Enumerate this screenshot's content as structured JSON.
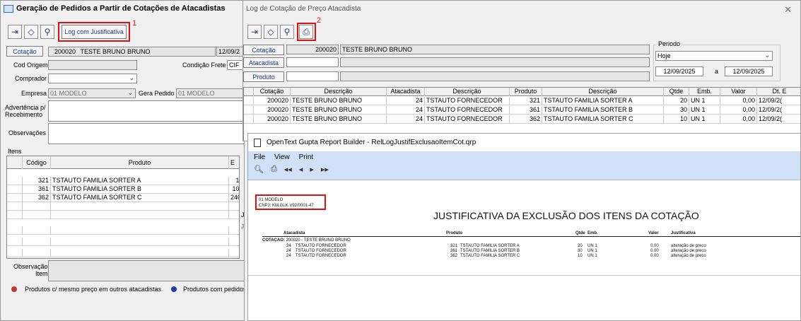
{
  "win1": {
    "title": "Geração de Pedidos a Partir de Cotações de Atacadistas",
    "log_button": "Log com Justificativa",
    "callout": "1",
    "cotacao_button": "Cotação",
    "cotacao_code": "200020",
    "cotacao_name": "TESTE BRUNO BRUNO",
    "cotacao_date": "12/09/2",
    "cod_origem_label": "Cod Origem",
    "condicao_frete_label": "Condição Frete",
    "condicao_frete_value": "CIF",
    "comprador_label": "Comprador",
    "empresa_label": "Empresa",
    "empresa_value": "01 MODELO",
    "gera_pedido_label": "Gera Pedido",
    "gera_pedido_value": "01 MODELO",
    "advertencia_label_1": "Advertência p/",
    "advertencia_label_2": "Recebimento",
    "observacoes_label": "Observações",
    "itens_label": "Itens",
    "items_headers": [
      "Código",
      "Produto",
      "E"
    ],
    "items": [
      {
        "codigo": "321",
        "produto": "TSTAUTO FAMILIA SORTER A",
        "e": "1,"
      },
      {
        "codigo": "361",
        "produto": "TSTAUTO FAMILIA SORTER B",
        "e": "10,"
      },
      {
        "codigo": "362",
        "produto": "TSTAUTO FAMILIA SORTER C",
        "e": "240,"
      }
    ],
    "side_label_j": "J",
    "side_label_ja": "Ja",
    "obs_item_label_1": "Observação",
    "obs_item_label_2": "Item",
    "legend_1": "Produtos c/ mesmo preço em outros atacadistas",
    "legend_2": "Produtos com pedidos e",
    "legend_1_color": "#c0392b",
    "legend_2_color": "#1f3fa6"
  },
  "win2": {
    "title": "Log de Cotação de Preço Atacadista",
    "callout": "2",
    "cotacao_button": "Cotação",
    "cotacao_code": "200020",
    "cotacao_name": "TESTE BRUNO BRUNO",
    "atacadista_button": "Atacadista",
    "produto_button": "Produto",
    "periodo_label": "Periodo",
    "periodo_value": "Hoje",
    "date_from": "12/09/2025",
    "date_sep": "a",
    "date_to": "12/09/2025",
    "headers": [
      "Cotação",
      "Descrição",
      "Atacadista",
      "Descrição",
      "Produto",
      "Descrição",
      "Qtde",
      "Emb.",
      "Valor",
      "Dt. E"
    ],
    "rows": [
      {
        "cot": "200020",
        "desc": "TESTE BRUNO BRUNO",
        "atac": "24",
        "desc2": "TSTAUTO FORNECEDOR",
        "prod": "321",
        "desc3": "TSTAUTO FAMILIA SORTER A",
        "qtde": "20",
        "emb": "UN 1",
        "valor": "0,00",
        "dt": "12/09/2("
      },
      {
        "cot": "200020",
        "desc": "TESTE BRUNO BRUNO",
        "atac": "24",
        "desc2": "TSTAUTO FORNECEDOR",
        "prod": "361",
        "desc3": "TSTAUTO FAMILIA SORTER B",
        "qtde": "30",
        "emb": "UN 1",
        "valor": "0,00",
        "dt": "12/09/2("
      },
      {
        "cot": "200020",
        "desc": "TESTE BRUNO BRUNO",
        "atac": "24",
        "desc2": "TSTAUTO FORNECEDOR",
        "prod": "362",
        "desc3": "TSTAUTO FAMILIA SORTER C",
        "qtde": "10",
        "emb": "UN 1",
        "valor": "0,00",
        "dt": "12/09/2("
      }
    ]
  },
  "win3": {
    "title": "OpenText Gupta Report Builder - RelLogJustifExclusaoItemCot.qrp",
    "menu": [
      "File",
      "View",
      "Print"
    ],
    "report": {
      "company": "01 MODELO",
      "cnpj": "CNPJ: KM.GLK.V92/0001-47",
      "heading": "JUSTIFICATIVA DA EXCLUSÃO DOS ITENS DA COTAÇÃO",
      "col_atacadista": "Atacadista",
      "col_produto": "Produto",
      "col_qtde": "Qtde",
      "col_emb": "Emb.",
      "col_valor": "Valor",
      "col_justificativa": "Justificativa",
      "cotacao_label": "COTAÇAO:",
      "cotacao_value": "200020 - TESTE BRUNO BRUNO",
      "lines": [
        {
          "atac": "24",
          "atac_name": "TSTAUTO FORNECEDOR",
          "prod": "321",
          "prod_name": "TSTAUTO FAMILIA SORTER A",
          "qtde": "20",
          "emb": "UN 1",
          "valor": "0.00",
          "just": "alteração de preco"
        },
        {
          "atac": "24",
          "atac_name": "TSTAUTO FORNECEDOR",
          "prod": "361",
          "prod_name": "TSTAUTO FAMILIA SORTER B",
          "qtde": "30",
          "emb": "UN 1",
          "valor": "0.00",
          "just": "alteração de preco"
        },
        {
          "atac": "24",
          "atac_name": "TSTAUTO FORNECEDOR",
          "prod": "362",
          "prod_name": "TSTAUTO FAMILIA SORTER C",
          "qtde": "10",
          "emb": "UN 1",
          "valor": "0.00",
          "just": "alteração de preco"
        }
      ]
    }
  },
  "colors": {
    "highlight_red": "#e01010",
    "toolbar_blue": "#cfe0f7"
  }
}
